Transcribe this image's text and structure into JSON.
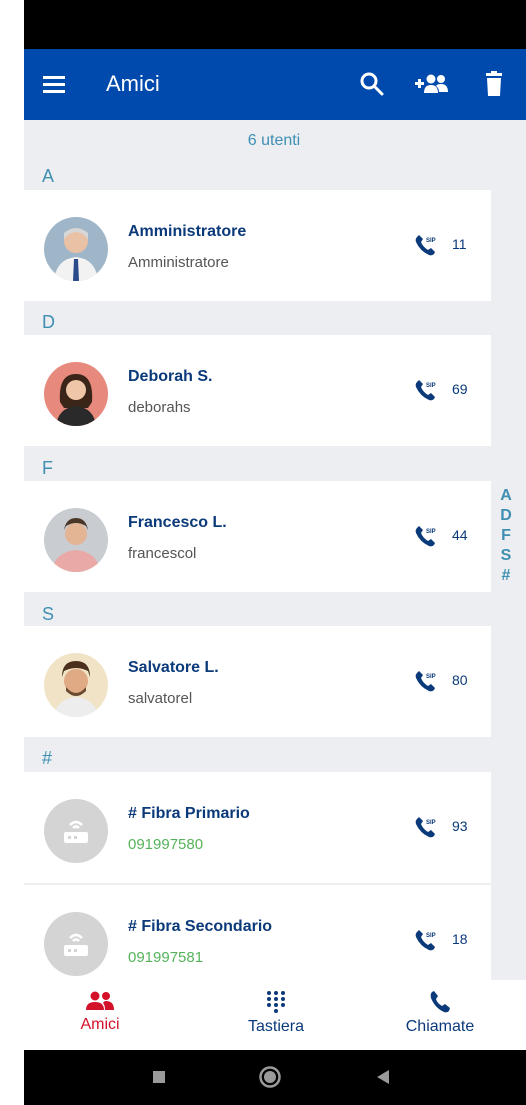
{
  "header": {
    "title": "Amici"
  },
  "summary": {
    "count_label": "6 utenti"
  },
  "sections": [
    "A",
    "D",
    "F",
    "S",
    "#"
  ],
  "contacts": [
    {
      "name": "Amministratore",
      "sub": "Amministratore",
      "ext": "11"
    },
    {
      "name": "Deborah S.",
      "sub": "deborahs",
      "ext": "69"
    },
    {
      "name": "Francesco L.",
      "sub": "francescol",
      "ext": "44"
    },
    {
      "name": "Salvatore L.",
      "sub": "salvatorel",
      "ext": "80"
    },
    {
      "name": "# Fibra Primario",
      "sub": "091997580",
      "ext": "93"
    },
    {
      "name": "# Fibra Secondario",
      "sub": "091997581",
      "ext": "18"
    }
  ],
  "index_letters": [
    "A",
    "D",
    "F",
    "S",
    "#"
  ],
  "sip_badge": "SIP",
  "nav": {
    "amici": "Amici",
    "tastiera": "Tastiera",
    "chiamate": "Chiamate"
  },
  "colors": {
    "primary": "#004aad",
    "accent": "#d3122a",
    "section": "#3f8fb3",
    "number_green": "#56b35a"
  }
}
